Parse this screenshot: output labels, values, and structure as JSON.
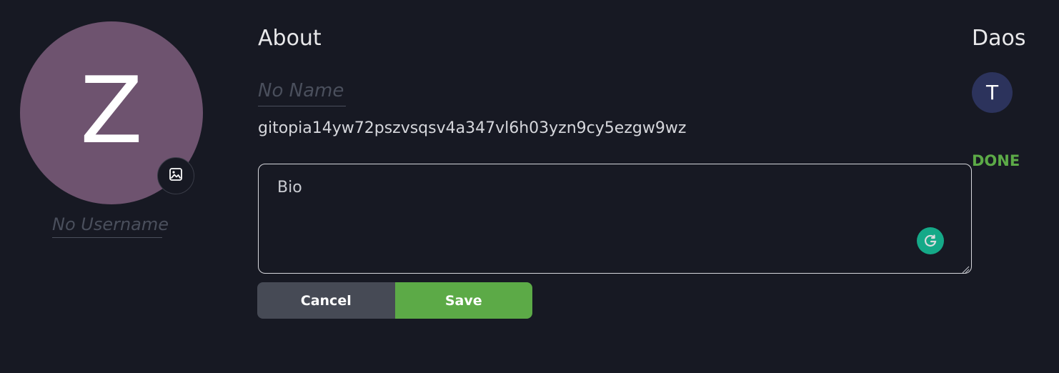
{
  "profile": {
    "avatar_letter": "Z",
    "avatar_color": "#6e536f",
    "username_placeholder": "No Username"
  },
  "about": {
    "title": "About",
    "name_placeholder": "No Name",
    "address": "gitopia14yw72pszvsqsv4a347vl6h03yzn9cy5ezgw9wz",
    "bio_placeholder": "Bio",
    "cancel_label": "Cancel",
    "save_label": "Save"
  },
  "daos": {
    "title": "Daos",
    "items": [
      {
        "letter": "T",
        "color": "#2c335c"
      }
    ],
    "done_label": "DONE"
  },
  "colors": {
    "background": "#171923",
    "accent_green": "#5caa47",
    "button_gray": "#464a55"
  }
}
